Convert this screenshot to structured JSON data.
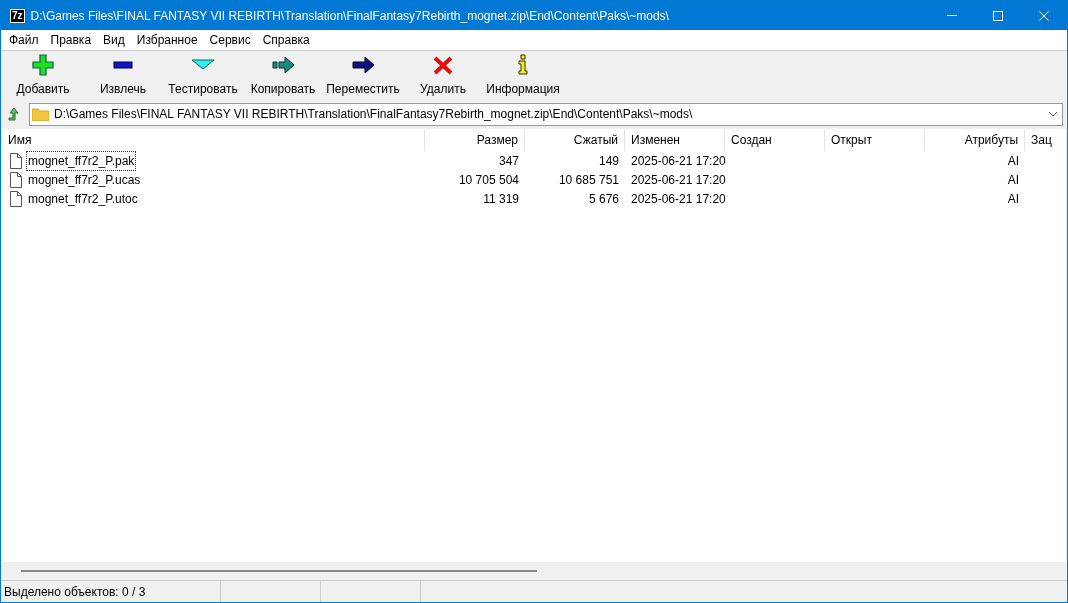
{
  "window": {
    "app_badge": "7z",
    "title": "D:\\Games Files\\FINAL FANTASY VII REBIRTH\\Translation\\FinalFantasy7Rebirth_mognet.zip\\End\\Content\\Paks\\~mods\\"
  },
  "menu": [
    "Файл",
    "Правка",
    "Вид",
    "Избранное",
    "Сервис",
    "Справка"
  ],
  "toolbar": [
    {
      "kind": "add",
      "label": "Добавить"
    },
    {
      "kind": "extract",
      "label": "Извлечь"
    },
    {
      "kind": "test",
      "label": "Тестировать"
    },
    {
      "kind": "copy",
      "label": "Копировать"
    },
    {
      "kind": "move",
      "label": "Переместить"
    },
    {
      "kind": "delete",
      "label": "Удалить"
    },
    {
      "kind": "info",
      "label": "Информация"
    }
  ],
  "address": {
    "value": "D:\\Games Files\\FINAL FANTASY VII REBIRTH\\Translation\\FinalFantasy7Rebirth_mognet.zip\\End\\Content\\Paks\\~mods\\"
  },
  "table": {
    "columns": [
      "Имя",
      "Размер",
      "Сжатый",
      "Изменен",
      "Создан",
      "Открыт",
      "Атрибуты",
      "Зац"
    ],
    "rows": [
      {
        "name": "mognet_ff7r2_P.pak",
        "size": "347",
        "packed": "149",
        "modified": "2025-06-21 17:20",
        "attributes": "AI",
        "focused": true
      },
      {
        "name": "mognet_ff7r2_P.ucas",
        "size": "10 705 504",
        "packed": "10 685 751",
        "modified": "2025-06-21 17:20",
        "attributes": "AI",
        "focused": false
      },
      {
        "name": "mognet_ff7r2_P.utoc",
        "size": "11 319",
        "packed": "5 676",
        "modified": "2025-06-21 17:20",
        "attributes": "AI",
        "focused": false
      }
    ]
  },
  "status_bar": "Выделено объектов: 0 / 3"
}
